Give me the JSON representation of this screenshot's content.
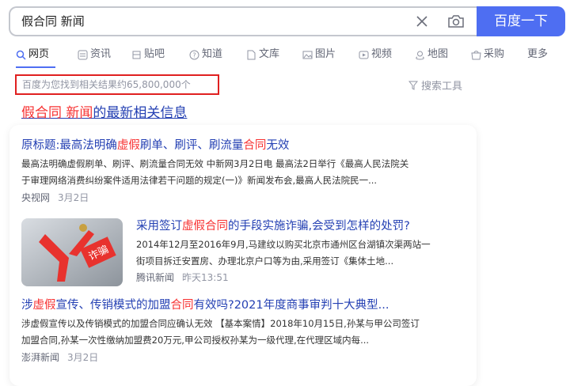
{
  "search": {
    "query": "假合同 新闻",
    "button": "百度一下"
  },
  "tabs": [
    {
      "label": "网页",
      "icon": "search-icon",
      "active": true
    },
    {
      "label": "资讯",
      "icon": "news-icon"
    },
    {
      "label": "贴吧",
      "icon": "tieba-icon"
    },
    {
      "label": "知道",
      "icon": "question-icon"
    },
    {
      "label": "文库",
      "icon": "document-icon"
    },
    {
      "label": "图片",
      "icon": "image-icon"
    },
    {
      "label": "视频",
      "icon": "video-icon"
    },
    {
      "label": "地图",
      "icon": "map-icon"
    },
    {
      "label": "采购",
      "icon": "shop-icon"
    },
    {
      "label": "更多"
    }
  ],
  "result_count": "百度为您找到相关结果约65,800,000个",
  "search_tools": "搜索工具",
  "news_header": {
    "highlight": "假合同 新闻",
    "rest": "的最新相关信息"
  },
  "news": [
    {
      "title_parts": [
        "原标题:最高法明确",
        "虚假",
        "刷单、刷评、刷流量",
        "合同",
        "无效"
      ],
      "snippet_line1": "最高法明确虚假刷单、刷评、刷流量合同无效 中新网3月2日电 最高法2日举行《最高人民法院关",
      "snippet_line2": "于审理网络消费纠纷案件适用法律若干问题的规定(一)》新闻发布会,最高人民法院民一...",
      "source": "央视网",
      "time": "3月2日"
    },
    {
      "title_parts": [
        "采用签订",
        "虚假合同",
        "的手段实施诈骗,会受到怎样的处罚?"
      ],
      "snippet_line1": "2014年12月至2016年9月,马建纹以购买北京市通州区台湖镇次渠两站一",
      "snippet_line2": "街项目拆迁安置房、办理北京户口等为由,采用签订《集体土地...",
      "source": "腾讯新闻",
      "time": "昨天13:51",
      "image_text": "诈骗"
    },
    {
      "title_parts": [
        "涉",
        "虚假",
        "宣传、传销模式的加盟",
        "合同",
        "有效吗?2021年度商事审判十大典型..."
      ],
      "snippet_line1": "涉虚假宣传以及传销模式的加盟合同应确认无效 【基本案情】2018年10月15日,孙某与甲公司签订",
      "snippet_line2": "加盟合同,孙某一次性缴纳加盟费20万元,甲公司授权孙某为一级代理,在代理区域内每...",
      "source": "澎湃新闻",
      "time": "3月2日"
    }
  ],
  "colors": {
    "accent": "#4e6ef2",
    "link": "#2440b3",
    "highlight": "#f73131",
    "box": "#e02020"
  }
}
